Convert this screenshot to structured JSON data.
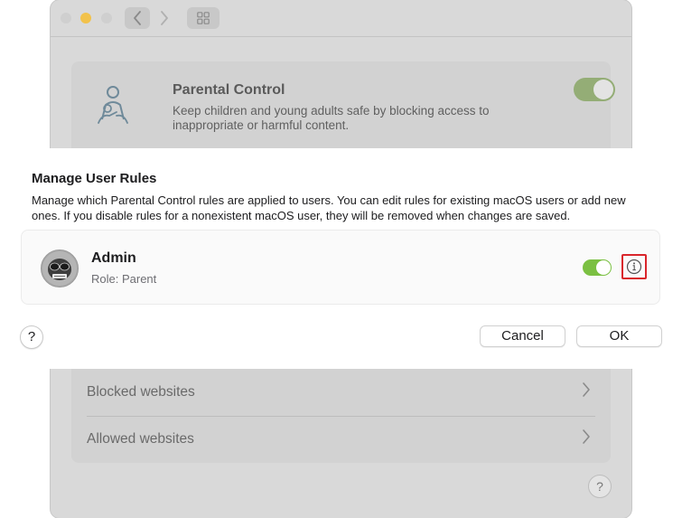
{
  "background_window": {
    "parental_control": {
      "title": "Parental Control",
      "description": "Keep children and young adults safe by blocking access to inappropriate or harmful content.",
      "enabled": true
    },
    "list_items": [
      {
        "label": "Blocked websites"
      },
      {
        "label": "Allowed websites"
      }
    ],
    "help_label": "?"
  },
  "sheet": {
    "title": "Manage User Rules",
    "description": "Manage which Parental Control rules are applied to users. You can edit rules for existing macOS users or add new ones. If you disable rules for a nonexistent macOS user, they will be removed when changes are saved.",
    "user": {
      "name": "Admin",
      "role": "Role: Parent",
      "enabled": true
    },
    "help_label": "?",
    "cancel_label": "Cancel",
    "ok_label": "OK"
  },
  "colors": {
    "toggle_on": "#7bc042",
    "highlight_border": "#d9252b",
    "dimmed_background": "#d9d9d9"
  },
  "icons": {
    "traffic_lights": [
      "close-icon",
      "minimize-icon",
      "maximize-icon"
    ],
    "navigation": [
      "chevron-left-icon",
      "chevron-right-icon",
      "grid-view-icon"
    ],
    "parental_control": "parent-child-icon",
    "info": "info-circle-icon",
    "row_chevron": "chevron-right-icon"
  }
}
